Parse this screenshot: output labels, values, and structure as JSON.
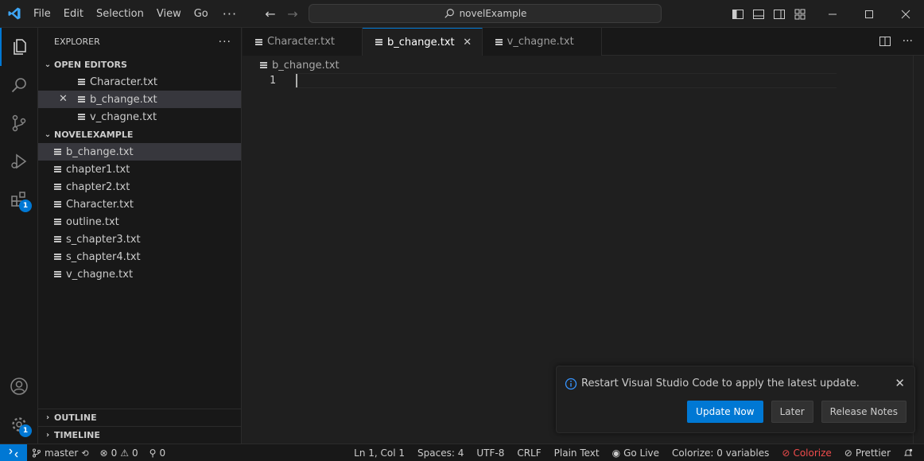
{
  "menu": [
    "File",
    "Edit",
    "Selection",
    "View",
    "Go"
  ],
  "menu_more": "···",
  "command_center": {
    "text": "novelExample",
    "icon": "search-icon"
  },
  "explorer": {
    "title": "EXPLORER",
    "more": "···",
    "open_editors": {
      "title": "OPEN EDITORS",
      "items": [
        "Character.txt",
        "b_change.txt",
        "v_chagne.txt"
      ]
    },
    "folder": {
      "title": "NOVELEXAMPLE",
      "items": [
        "b_change.txt",
        "chapter1.txt",
        "chapter2.txt",
        "Character.txt",
        "outline.txt",
        "s_chapter3.txt",
        "s_chapter4.txt",
        "v_chagne.txt"
      ]
    },
    "outline_title": "OUTLINE",
    "timeline_title": "TIMELINE"
  },
  "activity_badges": {
    "extensions": "1",
    "manage": "1"
  },
  "tabs": [
    "Character.txt",
    "b_change.txt",
    "v_chagne.txt"
  ],
  "breadcrumb": "b_change.txt",
  "editor": {
    "line_number": "1"
  },
  "notification": {
    "message": "Restart Visual Studio Code to apply the latest update.",
    "buttons": [
      "Update Now",
      "Later",
      "Release Notes"
    ]
  },
  "status": {
    "branch": "master",
    "errors": "0",
    "warnings": "0",
    "ports": "0",
    "position": "Ln 1, Col 1",
    "spaces": "Spaces: 4",
    "encoding": "UTF-8",
    "eol": "CRLF",
    "language": "Plain Text",
    "golive": "Go Live",
    "colorize_vars": "Colorize: 0 variables",
    "colorize": "Colorize",
    "prettier": "Prettier"
  },
  "colors": {
    "accent": "#0078d4",
    "error": "#f14c4c",
    "background": "#1f1f1f",
    "sidebar": "#181818"
  }
}
